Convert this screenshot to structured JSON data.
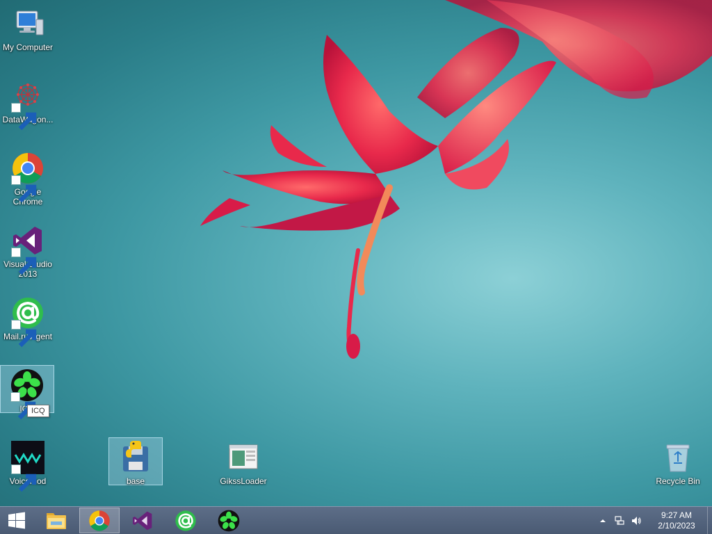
{
  "desktop": {
    "icons": [
      {
        "label": "My Computer"
      },
      {
        "label": "DataWagon..."
      },
      {
        "label": "Google Chrome"
      },
      {
        "label": "Visual Studio 2013"
      },
      {
        "label": "Mail.ru Agent"
      },
      {
        "label": "ICQ"
      },
      {
        "label": "Voicemod"
      },
      {
        "label": "base"
      },
      {
        "label": "GikssLoader"
      },
      {
        "label": "Recycle Bin"
      }
    ],
    "tooltip": "ICQ"
  },
  "taskbar": {
    "pinned": [
      {
        "icon": "file-explorer-icon"
      },
      {
        "icon": "chrome-icon"
      },
      {
        "icon": "visual-studio-icon"
      },
      {
        "icon": "mailru-agent-icon"
      },
      {
        "icon": "icq-icon"
      }
    ],
    "active_app": "chrome-icon",
    "clock": {
      "time": "9:27 AM",
      "date": "2/10/2023"
    }
  },
  "colors": {
    "taskbar": "#4f5f79",
    "chrome_red": "#db4437",
    "chrome_yellow": "#f4c20d",
    "chrome_green": "#0f9d58",
    "chrome_blue": "#4285f4",
    "vs_purple": "#68217a",
    "mailru_green": "#2fbd4c",
    "icq_green": "#3ce04a"
  }
}
